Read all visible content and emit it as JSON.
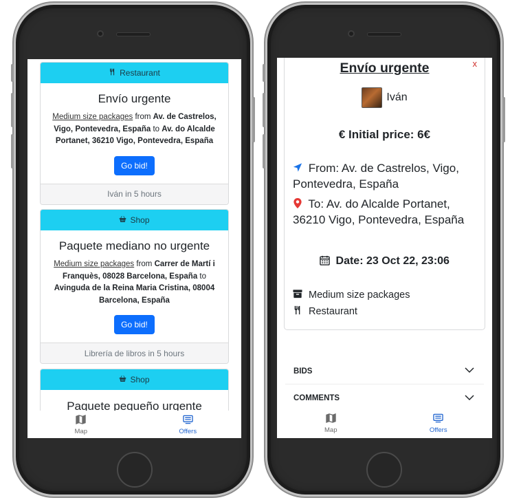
{
  "list_screen": {
    "offers": [
      {
        "category": "Restaurant",
        "category_icon": "utensils-icon",
        "title": "Envío urgente",
        "package": "Medium size packages",
        "from_word": " from ",
        "from": "Av. de Castrelos, Vigo, Pontevedra, España",
        "to_word": " to ",
        "to": "Av. do Alcalde Portanet, 36210 Vigo, Pontevedra, España",
        "button": "Go bid!",
        "footer": "Iván in 5 hours"
      },
      {
        "category": "Shop",
        "category_icon": "basket-icon",
        "title": "Paquete mediano no urgente",
        "package": "Medium size packages",
        "from_word": " from ",
        "from": "Carrer de Martí i Franquès, 08028 Barcelona, España",
        "to_word": " to ",
        "to": "Avinguda de la Reina Maria Cristina, 08004 Barcelona, España",
        "button": "Go bid!",
        "footer": "Librería de libros in 5 hours"
      },
      {
        "category": "Shop",
        "category_icon": "basket-icon",
        "title": "Paquete pequeño urgente"
      }
    ]
  },
  "tabs": [
    {
      "label": "Map",
      "icon": "map-icon"
    },
    {
      "label": "Offers",
      "icon": "offers-icon",
      "active": true
    }
  ],
  "detail_screen": {
    "close": "x",
    "title": "Envío urgente",
    "user": "Iván",
    "price": "€ Initial price: 6€",
    "from": "From: Av. de Castrelos, Vigo, Pontevedra, España",
    "to": "To: Av. do Alcalde Portanet, 36210 Vigo, Pontevedra, España",
    "date": "Date: 23 Oct 22, 23:06",
    "package": "Medium size packages",
    "category": "Restaurant",
    "accordions": [
      "BIDS",
      "COMMENTS"
    ]
  },
  "colors": {
    "card_header": "#1dcff1",
    "button": "#0d6efd",
    "active_tab": "#1e63cf",
    "from_icon": "#1a73e8",
    "to_icon": "#e53935",
    "close": "#d0312d"
  }
}
